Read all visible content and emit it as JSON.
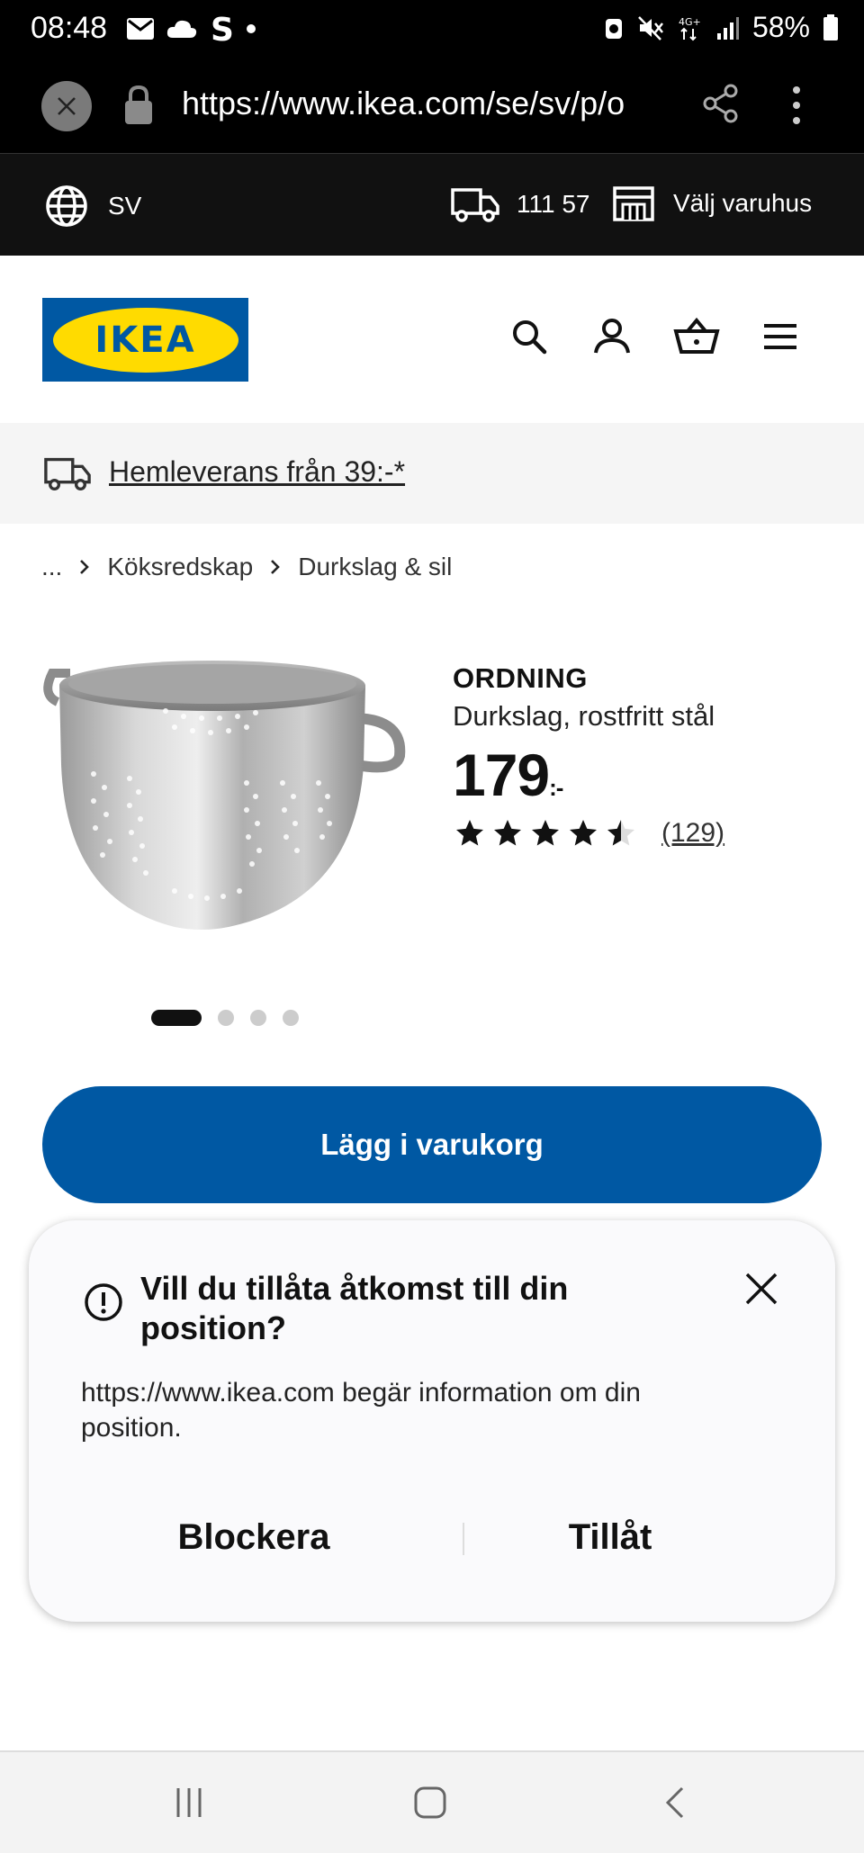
{
  "status_bar": {
    "time": "08:48",
    "battery": "58%"
  },
  "browser": {
    "url": "https://www.ikea.com/se/sv/p/o"
  },
  "top_strip": {
    "language": "SV",
    "postal_code": "111 57",
    "store_label": "Välj varuhus"
  },
  "header": {
    "logo_text": "IKEA"
  },
  "banner": {
    "delivery_text": "Hemleverans från 39:-*"
  },
  "breadcrumb": {
    "ellipsis": "...",
    "items": [
      "Köksredskap",
      "Durkslag & sil"
    ]
  },
  "product": {
    "name": "ORDNING",
    "description": "Durkslag, rostfritt stål",
    "price": "179",
    "price_suffix": ":-",
    "rating_value": 4.5,
    "rating_count": "(129)",
    "image_count": 4,
    "active_image_index": 0
  },
  "actions": {
    "add_to_cart": "Lägg i varukorg"
  },
  "permission_dialog": {
    "title": "Vill du tillåta åtkomst till din position?",
    "message": "https://www.ikea.com begär information om din position.",
    "block_label": "Blockera",
    "allow_label": "Tillåt"
  },
  "colors": {
    "ikea_blue": "#0058a3",
    "ikea_yellow": "#ffdb00",
    "topbar_bg": "#111111"
  }
}
